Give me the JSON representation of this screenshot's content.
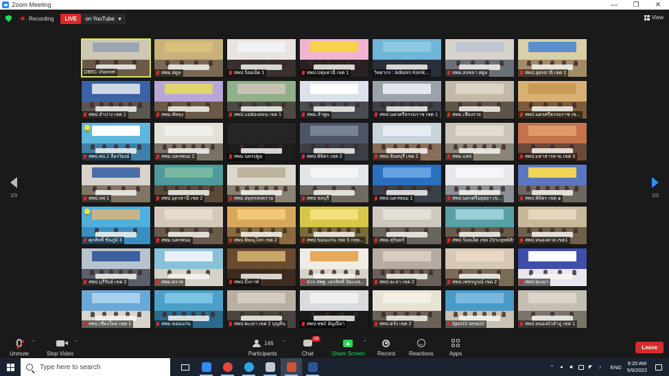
{
  "window": {
    "title": "Zoom Meeting"
  },
  "topbar": {
    "recording_label": "Recording",
    "live_label": "LIVE",
    "live_target": "on YouTube",
    "view_label": "View"
  },
  "gallery": {
    "page_indicator_left": "1/3",
    "page_indicator_right": "1/3",
    "tiles": [
      {
        "label": "OBEC channel",
        "muted": false,
        "active": true,
        "wall": "#cfc7b6",
        "floor": "#6b5a48",
        "banner": "#9aa6b4"
      },
      {
        "label": "สพม.สตูล",
        "muted": true,
        "active": false,
        "wall": "#c9b27a",
        "floor": "#7a6a55",
        "banner": "#d8c27a"
      },
      {
        "label": "สพป.ร้อยเอ็ด 1",
        "muted": true,
        "active": false,
        "wall": "#e8e4de",
        "floor": "#3a3030",
        "banner": "#f2f2f2"
      },
      {
        "label": "สพป.ปทุมธานี เขต 1",
        "muted": true,
        "active": false,
        "wall": "#f0b4d0",
        "floor": "#2a2222",
        "banner": "#f7d24a"
      },
      {
        "label": "วิทยากร : Adisorn Kornk...",
        "muted": false,
        "active": false,
        "wall": "#6fb6d8",
        "floor": "#2b2f3b",
        "banner": "#8bc9e3"
      },
      {
        "label": "สพม.สงขลา สตูล",
        "muted": true,
        "active": false,
        "wall": "#d7d3cd",
        "floor": "#6b6f78",
        "banner": "#bfc7d2"
      },
      {
        "label": "สพป.อุดรธานี เขต 1",
        "muted": true,
        "active": false,
        "wall": "#d9cfa7",
        "floor": "#a38b66",
        "banner": "#5b8ecb"
      },
      {
        "label": "สพป.ลำปาง เขต 1",
        "muted": true,
        "active": false,
        "wall": "#3c63a8",
        "floor": "#5c5650",
        "banner": "#cfd6e4"
      },
      {
        "label": "สพม.พัทลุง",
        "muted": true,
        "active": false,
        "wall": "#b8a6d8",
        "floor": "#6b5a48",
        "banner": "#e0d46b"
      },
      {
        "label": "สพป.แม่ฮ่องสอน เขต 1",
        "muted": true,
        "active": false,
        "wall": "#8fb08a",
        "floor": "#4e4a42",
        "banner": "#c8c2b6"
      },
      {
        "label": "สพม.ลำพูน",
        "muted": true,
        "active": false,
        "wall": "#d9e2ea",
        "floor": "#4a4d52",
        "banner": "#ffffff"
      },
      {
        "label": "สพป.นครศรีธรรมราช เขต 1",
        "muted": true,
        "active": false,
        "wall": "#9aa3ab",
        "floor": "#3d4148",
        "banner": "#e3e6ea"
      },
      {
        "label": "สพม.เชียงราย",
        "muted": true,
        "active": false,
        "wall": "#c4b8a6",
        "floor": "#5e544a",
        "banner": "#dcd4c6"
      },
      {
        "label": "สพป.นครศรีธรรมราช เข...",
        "muted": true,
        "active": false,
        "wall": "#d8b073",
        "floor": "#7a5c3c",
        "banner": "#c99a58"
      },
      {
        "label": "สพป.พบ.1 ลือรวิมณ์",
        "muted": true,
        "active": false,
        "wall": "#5eb8de",
        "floor": "#3f7fa8",
        "banner": "#ffffff",
        "bulb": true
      },
      {
        "label": "สพม.นครพนม 2",
        "muted": true,
        "active": false,
        "wall": "#e4e0d8",
        "floor": "#7a7266",
        "banner": "#f0efe9"
      },
      {
        "label": "สพม.นครปฐม",
        "muted": true,
        "active": false,
        "wall": "#262626",
        "floor": "#1d1d1d",
        "banner": "#262626"
      },
      {
        "label": "สพป.พิจิตร เขต 2",
        "muted": true,
        "active": false,
        "wall": "#4c5566",
        "floor": "#3a3e46",
        "banner": "#7a8394"
      },
      {
        "label": "สพป.จันทบุรี เขต 2",
        "muted": true,
        "active": false,
        "wall": "#c7d3db",
        "floor": "#8a6f58",
        "banner": "#e8ecef"
      },
      {
        "label": "สพม.แพร่",
        "muted": true,
        "active": false,
        "wall": "#c9c4b6",
        "floor": "#8a8476",
        "banner": "#e2ddd0"
      },
      {
        "label": "สพป.มหาสารคาม เขต 3",
        "muted": true,
        "active": false,
        "wall": "#c6734a",
        "floor": "#6b4a38",
        "banner": "#e09a6a"
      },
      {
        "label": "สพป.ลพ 1",
        "muted": true,
        "active": false,
        "wall": "#d9d4cb",
        "floor": "#807566",
        "banner": "#4a6fa8"
      },
      {
        "label": "สพป.อุดรธานี เขต 2",
        "muted": true,
        "active": false,
        "wall": "#4e9a9c",
        "floor": "#5a4a3a",
        "banner": "#78b8a2"
      },
      {
        "label": "สพม.สมุทรสงคราม",
        "muted": true,
        "active": false,
        "wall": "#ddd8cc",
        "floor": "#8a8272",
        "banner": "#bdb49c"
      },
      {
        "label": "สพป.ชลบุรี",
        "muted": true,
        "active": false,
        "wall": "#e0e6ea",
        "floor": "#6f6a62",
        "banner": "#f2f4f6"
      },
      {
        "label": "สพป.นครพนม 1",
        "muted": true,
        "active": false,
        "wall": "#2b6fbf",
        "floor": "#3a3f48",
        "banner": "#65a0e0"
      },
      {
        "label": "สพป.นครศรีอยุธยา เข...",
        "muted": true,
        "active": false,
        "wall": "#e6e7e9",
        "floor": "#8c8f96",
        "banner": "#f5f6f7"
      },
      {
        "label": "สพป.พิจิตร เขต ๑",
        "muted": true,
        "active": false,
        "wall": "#5a78c0",
        "floor": "#6e6660",
        "banner": "#f0d45a"
      },
      {
        "label": "ศุภสิทธิ์ ขันภูมิ 3",
        "muted": true,
        "active": false,
        "wall": "#4fb0dd",
        "floor": "#3a8fc0",
        "banner": "#c7b48a",
        "bulb": true
      },
      {
        "label": "สพม.นครพนม",
        "muted": true,
        "active": false,
        "wall": "#d4c8b8",
        "floor": "#6a5a4c",
        "banner": "#e7dccc"
      },
      {
        "label": "สพป.พิษณุโลก เขต 2",
        "muted": true,
        "active": false,
        "wall": "#d8a85a",
        "floor": "#8a6a40",
        "banner": "#f0c878"
      },
      {
        "label": "สพป.ขอนแก่น เขต 5 กฤษ...",
        "muted": true,
        "active": false,
        "wall": "#d6c64a",
        "floor": "#7a6c3a",
        "banner": "#f2e07a"
      },
      {
        "label": "สพม.สุรินทร์",
        "muted": true,
        "active": false,
        "wall": "#cfc9bd",
        "floor": "#6a655c",
        "banner": "#e5e0d5"
      },
      {
        "label": "สพป.ร้อยเอ็ด เขต 2ประยุทธ์ศักดิ์",
        "muted": true,
        "active": false,
        "wall": "#5aa0a8",
        "floor": "#6a5a48",
        "banner": "#9ad0d8"
      },
      {
        "label": "สพป.หนองคาย เขต1",
        "muted": true,
        "active": false,
        "wall": "#c8b89a",
        "floor": "#6e604a",
        "banner": "#e2d6bc"
      },
      {
        "label": "สพป.บุรีรัมย์ เขต 2",
        "muted": true,
        "active": false,
        "wall": "#b8c3d0",
        "floor": "#5c5f68",
        "banner": "#3b5fa0"
      },
      {
        "label": "สพม.ตราด",
        "muted": true,
        "active": false,
        "wall": "#8ac0d8",
        "floor": "#d6d2c8",
        "banner": "#e8f2f6"
      },
      {
        "label": "สพป.บึงกาฬ",
        "muted": true,
        "active": false,
        "wall": "#6a4a30",
        "floor": "#3e2c20",
        "banner": "#c8a86a"
      },
      {
        "label": "สวก.สพฐ. เอกสิทธิ์ ปิยะแส...",
        "muted": true,
        "active": false,
        "wall": "#f0ece4",
        "floor": "#d8d2c8",
        "banner": "#e8a85a"
      },
      {
        "label": "สพป.ยะลา เขต 2",
        "muted": true,
        "active": false,
        "wall": "#b8aca0",
        "floor": "#6a6058",
        "banner": "#d8ccc0"
      },
      {
        "label": "สพป.เพชรบูรณ์ เขต 2",
        "muted": true,
        "active": false,
        "wall": "#d6c8b6",
        "floor": "#7a6a58",
        "banner": "#ead8c4"
      },
      {
        "label": "สพป.พะเยา",
        "muted": true,
        "active": false,
        "wall": "#3d4fa8",
        "floor": "#e8e6f0",
        "banner": "#ffffff"
      },
      {
        "label": "สพป.เชียงใหม่ เขต 1",
        "muted": true,
        "active": false,
        "wall": "#6aa8d8",
        "floor": "#d8d4cc",
        "banner": "#a8d0ec"
      },
      {
        "label": "สพม.ขอนแก่น",
        "muted": true,
        "active": false,
        "wall": "#4aa0c8",
        "floor": "#2a6a8c",
        "banner": "#7cc4e4"
      },
      {
        "label": "สพป.พะเยา เขต 2 บุญสิน",
        "muted": true,
        "active": false,
        "wall": "#b8b0a4",
        "floor": "#4a4440",
        "banner": "#d4ccc0"
      },
      {
        "label": "สพป.ชพ2 อัญณียา",
        "muted": true,
        "active": false,
        "wall": "#d8dcde",
        "floor": "#9a9e a2",
        "banner": "#eef0f1"
      },
      {
        "label": "สพป.ตรัง เขต 2",
        "muted": true,
        "active": false,
        "wall": "#e8e2d4",
        "floor": "#6a6256",
        "banner": "#f4efe4"
      },
      {
        "label": "Spm10 sesa10",
        "muted": true,
        "active": false,
        "wall": "#4a9ac8",
        "floor": "#c8c0b0",
        "banner": "#7ab8e0"
      },
      {
        "label": "สพป.หนองบัวลำภู เขต 1",
        "muted": true,
        "active": false,
        "wall": "#c4beb2",
        "floor": "#7a746a",
        "banner": "#dcd6ca"
      }
    ]
  },
  "toolbar": {
    "unmute_label": "Unmute",
    "stop_video_label": "Stop Video",
    "participants_label": "Participants",
    "participants_count": "146",
    "chat_label": "Chat",
    "chat_badge": "18",
    "share_label": "Share Screen",
    "record_label": "Record",
    "reactions_label": "Reactions",
    "apps_label": "Apps",
    "leave_label": "Leave"
  },
  "taskbar": {
    "search_placeholder": "Type here to search",
    "language": "ENG",
    "time": "9:20 AM",
    "date": "5/9/2022",
    "apps": [
      {
        "name": "task-view-icon",
        "color": "#ffffff"
      },
      {
        "name": "zoom-icon",
        "color": "#2d8cff"
      },
      {
        "name": "chrome-icon",
        "color": "#e8453c"
      },
      {
        "name": "edge-icon",
        "color": "#2fa4e0"
      },
      {
        "name": "shield-app-icon",
        "color": "#c0c8d0"
      },
      {
        "name": "powerpoint-icon",
        "color": "#d35230"
      },
      {
        "name": "word-icon",
        "color": "#2b5797"
      }
    ]
  }
}
